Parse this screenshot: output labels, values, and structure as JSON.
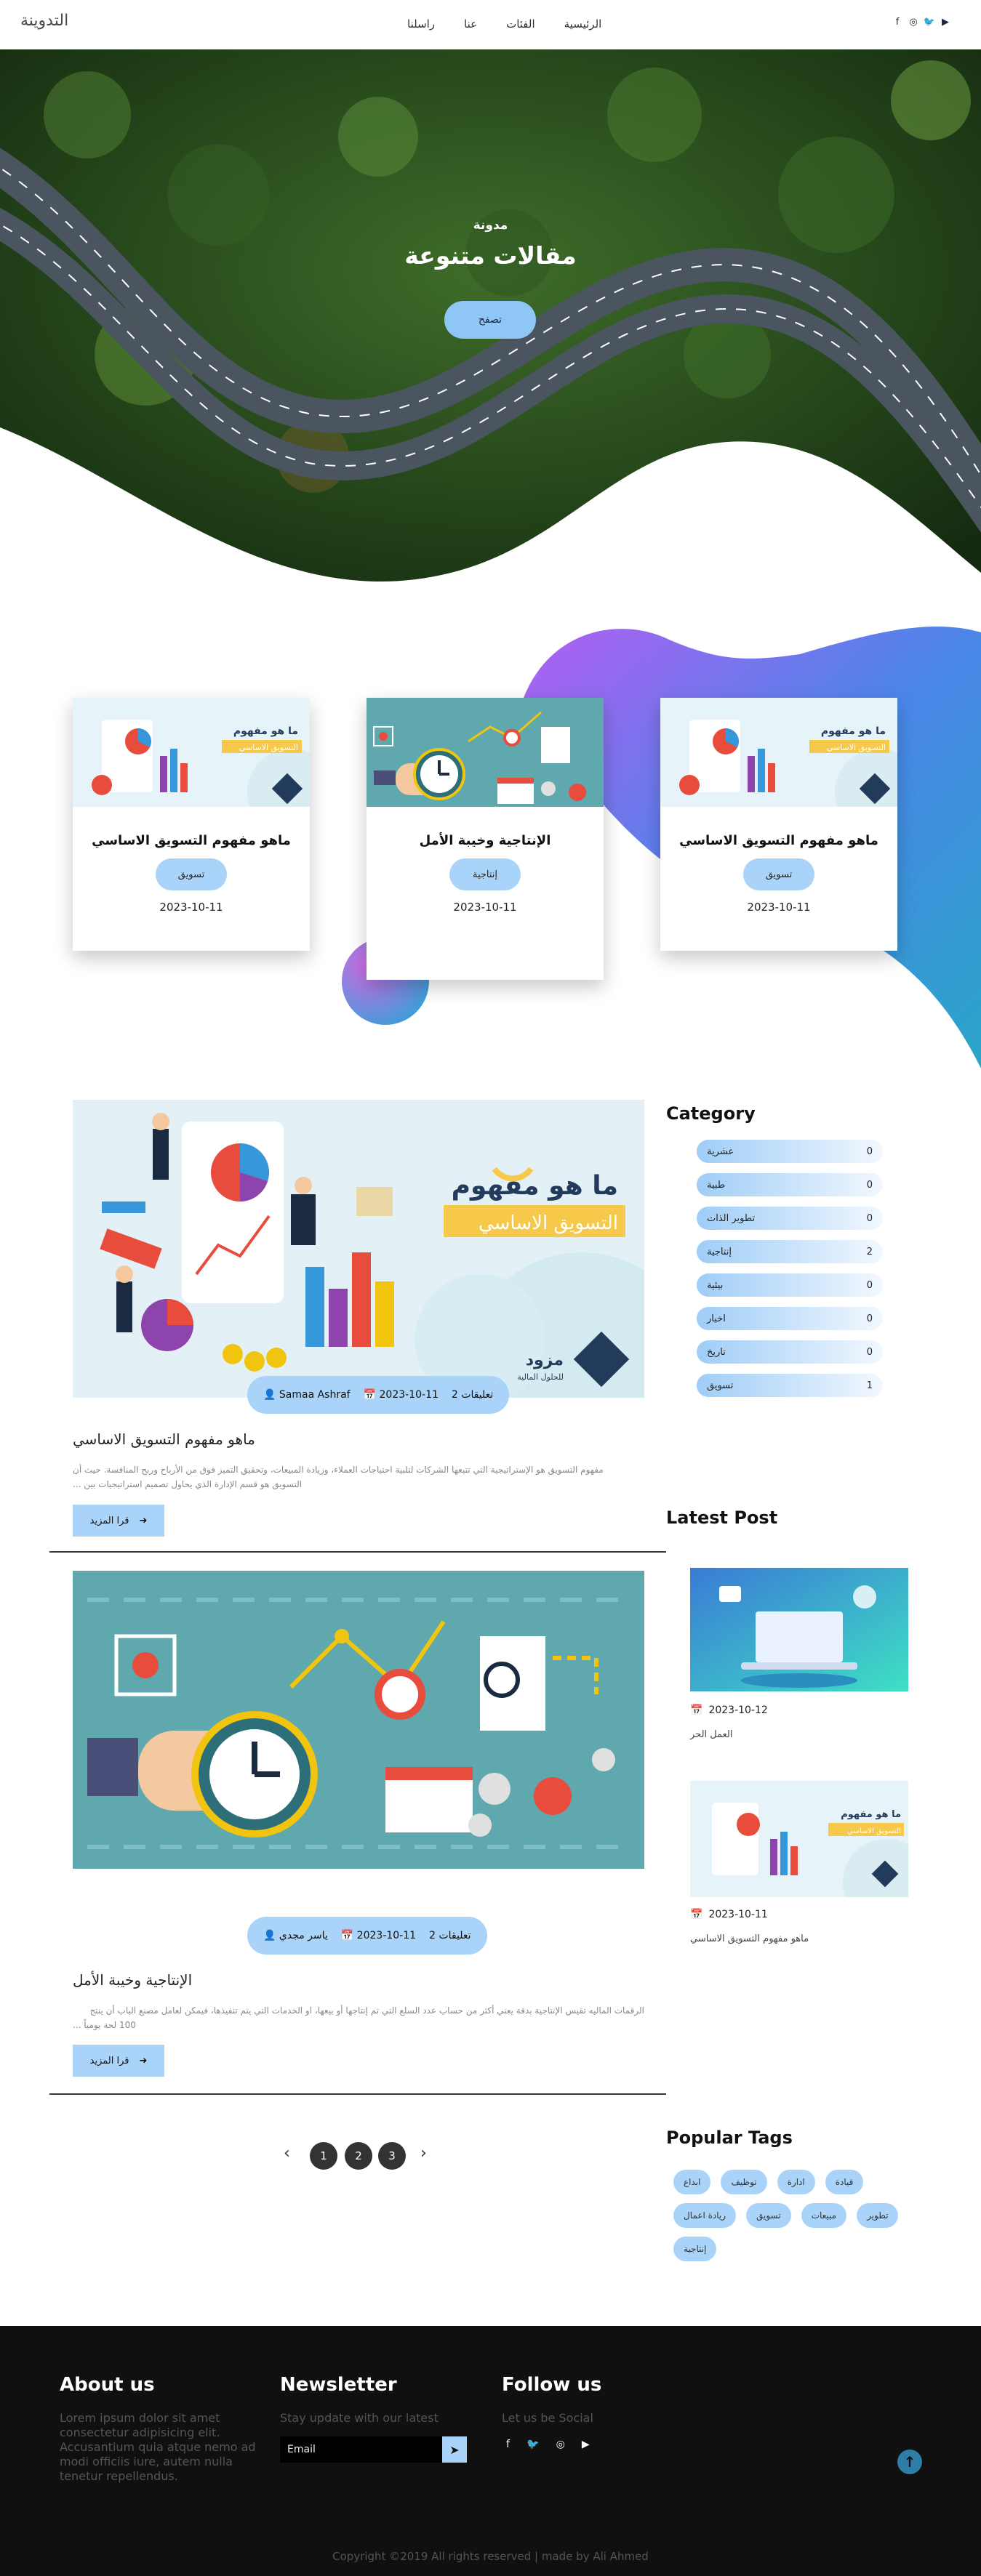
{
  "nav": {
    "logo": "التدوينة",
    "links": [
      "الرئيسية",
      "الفئات",
      "عنا",
      "راسلنا"
    ],
    "social": [
      "youtube-icon",
      "twitter-icon",
      "instagram-icon",
      "facebook-icon"
    ]
  },
  "hero": {
    "subtitle": "مدونة",
    "title": "مقالات متنوعة",
    "button": "تصفح"
  },
  "featured": [
    {
      "title": "ماهو مفهوم التسويق الاساسي",
      "badge": "تسويق",
      "date": "2023-10-11",
      "image": "marketing"
    },
    {
      "title": "الإنتاجية وخيبة الأمل",
      "badge": "إنتاجية",
      "date": "2023-10-11",
      "image": "productivity"
    },
    {
      "title": "ماهو مفهوم التسويق الاساسي",
      "badge": "تسويق",
      "date": "2023-10-11",
      "image": "marketing"
    }
  ],
  "thumb_text": {
    "line1": "ما هو مفهوم",
    "line2": "التسويق الاساسي",
    "brand": "مزود",
    "brand_sub": "للحلول المالية"
  },
  "posts": [
    {
      "author": "Samaa Ashraf",
      "date": "2023-10-11",
      "comments": "تعليقات 2",
      "title": "ماهو مفهوم التسويق الاساسي",
      "excerpt_1": "مفهوم التسويق هو الإستراتيجية التي تتبعها الشركات لتلبية احتياجات العملاء، وزيادة المبيعات، وتحقيق التميز فوق من الأرباح وربح المنافسة. حيث أن",
      "excerpt_2": "التسويق هو قسم الإدارة الذي يحاول تصميم استراتيجيات بين ...",
      "readmore": "قرا المزيد"
    },
    {
      "author": "ياسر مجدي",
      "date": "2023-10-11",
      "comments": "تعليقات 2",
      "title": "الإنتاجية وخيبة الأمل",
      "excerpt_1": "الرقمات الماليه تقيس الإنتاجية بدقة يعني أكثر من حساب عدد السلع التي تم إنتاجها أو بيعها، او الخدمات التي يتم تنفيذها، فيمكن لعامل مصنع الباب أن ينتج",
      "excerpt_2": "100 لحة يومياً ...",
      "readmore": "قرا المزيد"
    }
  ],
  "sidebar": {
    "category_title": "Category",
    "categories": [
      {
        "name": "عشرية",
        "count": "0"
      },
      {
        "name": "طبية",
        "count": "0"
      },
      {
        "name": "تطوير الذات",
        "count": "0"
      },
      {
        "name": "إنتاجية",
        "count": "2"
      },
      {
        "name": "بيئية",
        "count": "0"
      },
      {
        "name": "اخبار",
        "count": "0"
      },
      {
        "name": "تاريخ",
        "count": "0"
      },
      {
        "name": "تسويق",
        "count": "1"
      }
    ],
    "latest_title": "Latest Post",
    "latest": [
      {
        "date": "2023-10-12",
        "title": "العمل الحر"
      },
      {
        "date": "2023-10-11",
        "title": "ماهو مفهوم التسويق الاساسي"
      }
    ],
    "tags_title": "Popular Tags",
    "tags_row1": [
      "ابداع",
      "توظيف",
      "ادارة",
      "قيادة"
    ],
    "tags_row2": [
      "ريادة اعمال",
      "تسويق",
      "مبيعات",
      "تطوير"
    ],
    "tags_row3": [
      "إنتاجية"
    ]
  },
  "pagination": {
    "prev": "‹",
    "pages": [
      "1",
      "2",
      "3"
    ],
    "next": "›"
  },
  "footer": {
    "about_title": "About us",
    "about_lines": [
      "Lorem ipsum dolor sit amet",
      "consectetur adipisicing elit.",
      "Accusantium quia atque nemo ad",
      "modi officiis iure, autem nulla",
      "tenetur repellendus."
    ],
    "newsletter_title": "Newsletter",
    "newsletter_text": "Stay update with our latest",
    "email_placeholder": "Email",
    "follow_title": "Follow us",
    "follow_text": "Let us be Social",
    "social": [
      "facebook-icon",
      "twitter-icon",
      "instagram-icon",
      "youtube-icon"
    ],
    "copyright": "Copyright ©2019 All rights reserved | made by Ali Ahmed"
  },
  "colors": {
    "accent": "#a9d3f8",
    "dark": "#333333",
    "footer_bg": "#101010",
    "blob_purple": "#a463f5",
    "blob_blue": "#2196d8"
  }
}
